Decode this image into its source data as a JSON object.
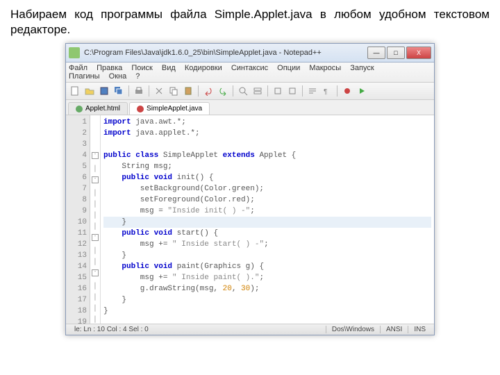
{
  "caption": "Набираем код программы файла Simple.Applet.java в любом удобном текстовом редакторе.",
  "window": {
    "title": "C:\\Program Files\\Java\\jdk1.6.0_25\\bin\\SimpleApplet.java - Notepad++",
    "minimize": "—",
    "maximize": "□",
    "close": "X"
  },
  "menu": [
    "Файл",
    "Правка",
    "Поиск",
    "Вид",
    "Кодировки",
    "Синтаксис",
    "Опции",
    "Макросы",
    "Запуск",
    "Плагины",
    "Окна",
    "?"
  ],
  "tabs": [
    {
      "label": "Applet.html",
      "active": false
    },
    {
      "label": "SimpleApplet.java",
      "active": true
    }
  ],
  "lines": [
    "1",
    "2",
    "3",
    "4",
    "5",
    "6",
    "7",
    "8",
    "9",
    "10",
    "11",
    "12",
    "13",
    "14",
    "15",
    "16",
    "17",
    "18",
    "19"
  ],
  "code": {
    "l1a": "import",
    "l1b": " java.awt.*;",
    "l2a": "import",
    "l2b": " java.applet.*;",
    "l4a": "public class",
    "l4b": " SimpleApplet ",
    "l4c": "extends",
    "l4d": " Applet {",
    "l5": "    String msg;",
    "l6a": "    public void",
    "l6b": " init() {",
    "l7": "        setBackground(Color.green);",
    "l8": "        setForeground(Color.red);",
    "l9a": "        msg = ",
    "l9b": "\"Inside init( ) -\"",
    "l9c": ";",
    "l10": "    }",
    "l11a": "    public void",
    "l11b": " start() {",
    "l12a": "        msg += ",
    "l12b": "\" Inside start( ) -\"",
    "l12c": ";",
    "l13": "    }",
    "l14a": "    public void",
    "l14b": " paint(Graphics g) {",
    "l15a": "        msg += ",
    "l15b": "\" Inside paint( ).\"",
    "l15c": ";",
    "l16a": "        g.drawString(msg, ",
    "l16b": "20",
    "l16c": ", ",
    "l16d": "30",
    "l16e": ");",
    "l17": "    }",
    "l18": "}"
  },
  "status": {
    "pos": "le: Ln : 10   Col : 4   Sel : 0",
    "eol": "Dos\\Windows",
    "enc": "ANSI",
    "mode": "INS"
  }
}
